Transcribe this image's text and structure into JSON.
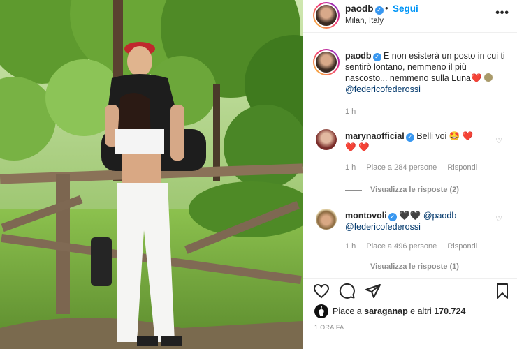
{
  "post": {
    "photo_alt": "",
    "colors": {
      "accent": "#0095f6",
      "link": "#00376b",
      "muted": "#8e8e8e",
      "verified": "#3897f0",
      "heart": "#ed4956"
    }
  },
  "header": {
    "username": "paodb",
    "verified_icon": "verified-badge-icon",
    "separator": "•",
    "follow_label": "Segui",
    "location": "Milan, Italy",
    "more_label": "•••"
  },
  "caption": {
    "username": "paodb",
    "text": "E non esisterà un posto in cui ti sentirò lontano, nemmeno il più nascosto... nemmeno sulla Luna",
    "emoji": "❤️",
    "mention": "@federicofederossi",
    "time": "1 h"
  },
  "comments": [
    {
      "username": "marynaofficial",
      "text": "Belli voi",
      "emojis": "🤩 ❤️",
      "emojis_line2": "❤️ ❤️",
      "time": "1 h",
      "likes": "Piace a 284 persone",
      "reply": "Rispondi",
      "view_replies": "Visualizza le risposte (2)"
    },
    {
      "username": "montovoli",
      "text_prefix": "🖤🖤",
      "mention1": "@paodb",
      "mention2": "@federicofederossi",
      "time": "1 h",
      "likes": "Piace a 496 persone",
      "reply": "Rispondi",
      "view_replies": "Visualizza le risposte (1)"
    }
  ],
  "actions": {
    "like_icon": "heart-icon",
    "comment_icon": "comment-icon",
    "share_icon": "share-icon",
    "save_icon": "bookmark-icon"
  },
  "likes": {
    "prefix": "Piace a ",
    "user": "saraganap",
    "middle": " e altri ",
    "count": "170.724"
  },
  "timestamp": "1 ORA FA"
}
